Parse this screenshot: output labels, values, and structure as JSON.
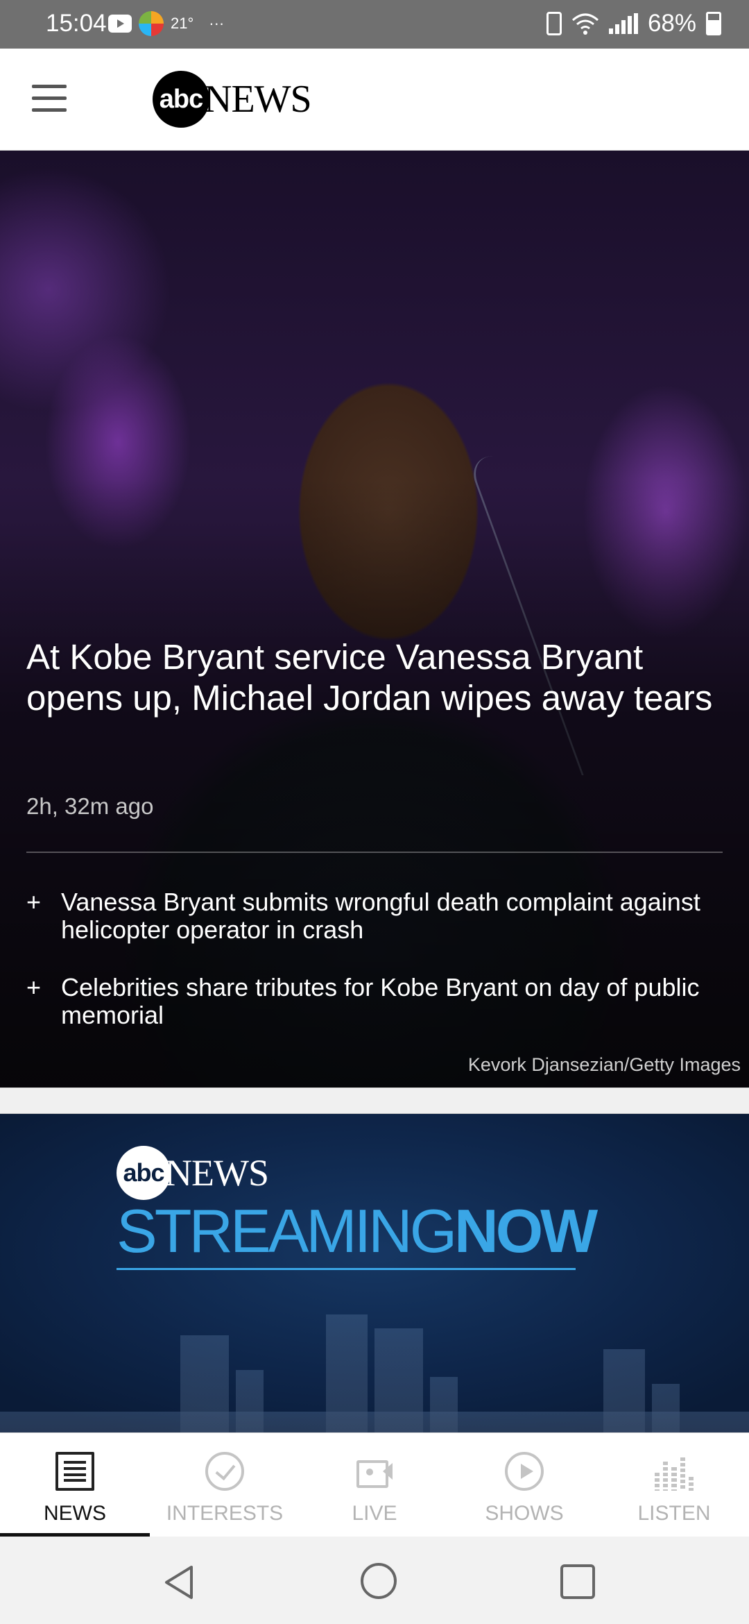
{
  "status_bar": {
    "time": "15:04",
    "temperature": "21°",
    "more": "···",
    "battery": "68%",
    "icons": [
      "youtube-icon",
      "weather-icon",
      "vibrate-icon",
      "wifi-icon",
      "signal-icon",
      "battery-icon"
    ]
  },
  "app_bar": {
    "logo_abc": "abc",
    "logo_news": "NEWS"
  },
  "hero": {
    "title": "At Kobe Bryant service Vanessa Bryant opens up, Michael Jordan wipes away tears",
    "time_ago": "2h, 32m ago",
    "related": [
      {
        "plus": "+",
        "text": "Vanessa Bryant submits wrongful death complaint against helicopter operator in crash"
      },
      {
        "plus": "+",
        "text": "Celebrities share tributes for Kobe Bryant on day of public memorial"
      }
    ],
    "credit": "Kevork Djansezian/Getty Images"
  },
  "streaming": {
    "logo_abc": "abc",
    "logo_news": "NEWS",
    "word_streaming": "STREAMING",
    "word_now": "NOW"
  },
  "bottom_nav": {
    "tabs": [
      {
        "label": "NEWS",
        "icon": "news-icon",
        "active": true
      },
      {
        "label": "INTERESTS",
        "icon": "check-circle-icon",
        "active": false
      },
      {
        "label": "LIVE",
        "icon": "video-camera-icon",
        "active": false
      },
      {
        "label": "SHOWS",
        "icon": "play-circle-icon",
        "active": false
      },
      {
        "label": "LISTEN",
        "icon": "equalizer-icon",
        "active": false
      }
    ]
  },
  "colors": {
    "status_bar": "#707070",
    "streaming_bg": "#0e2549",
    "streaming_accent": "#3aa6e6",
    "active_tab": "#111111",
    "inactive_tab": "#b3b3b3"
  }
}
